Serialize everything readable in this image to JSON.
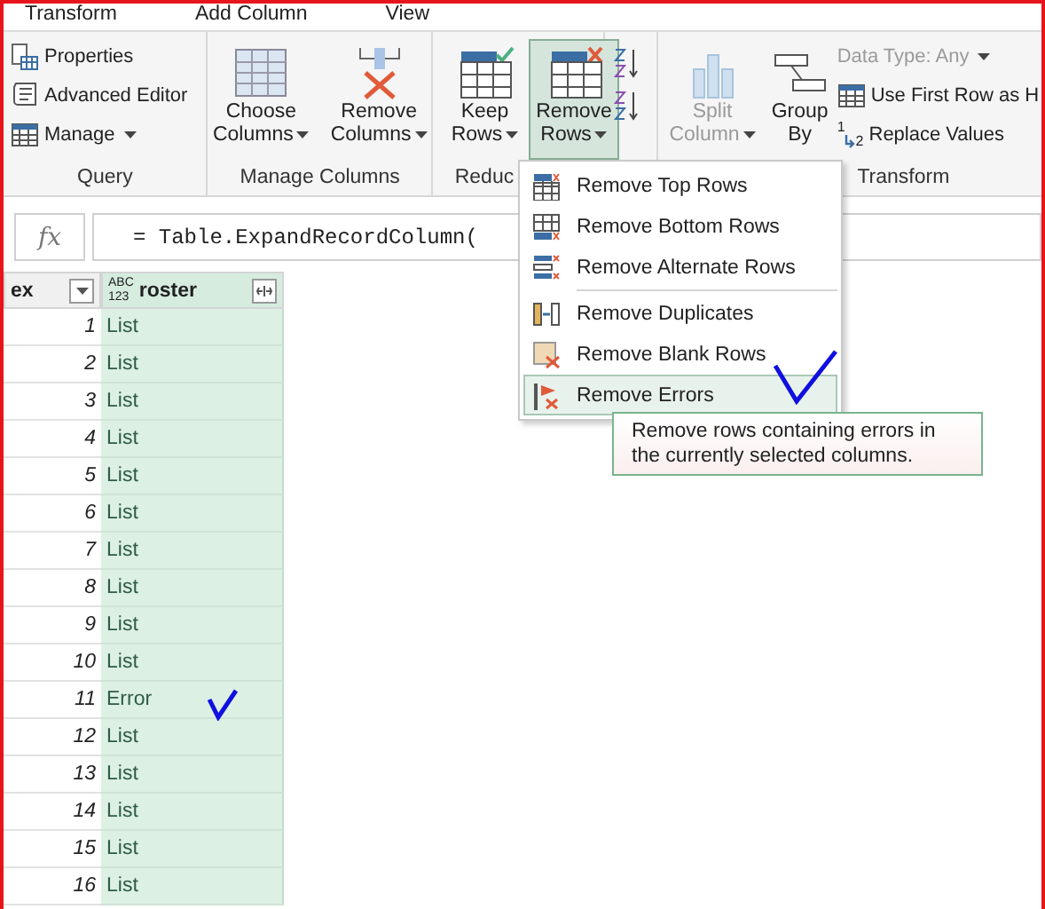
{
  "tabs": [
    {
      "label": "Transform"
    },
    {
      "label": "Add Column"
    },
    {
      "label": "View"
    }
  ],
  "query_group": {
    "label": "Query",
    "items": [
      {
        "label": "Properties",
        "has_menu": false
      },
      {
        "label": "Advanced Editor",
        "has_menu": false
      },
      {
        "label": "Manage",
        "has_menu": true
      }
    ]
  },
  "manage_group": {
    "label": "Manage Columns",
    "buttons": [
      {
        "lines": [
          "Choose",
          "Columns"
        ],
        "has_menu": true,
        "selected": false
      },
      {
        "lines": [
          "Remove",
          "Columns"
        ],
        "has_menu": true,
        "selected": false
      }
    ]
  },
  "reduce_group": {
    "label": "Reduc",
    "buttons": [
      {
        "lines": [
          "Keep",
          "Rows"
        ],
        "has_menu": true,
        "selected": false
      },
      {
        "lines": [
          "Remove",
          "Rows"
        ],
        "has_menu": true,
        "selected": true
      }
    ]
  },
  "transform_group": {
    "label": "Transform",
    "buttons": [
      {
        "lines": [
          "Split",
          "Column"
        ],
        "has_menu": true,
        "disabled": true
      },
      {
        "lines": [
          "Group",
          "By"
        ],
        "has_menu": false,
        "disabled": false
      }
    ],
    "small_items": [
      {
        "label": "Data Type: Any",
        "has_menu": true,
        "disabled": true
      },
      {
        "label": "Use First Row as H",
        "has_menu": false,
        "disabled": false
      },
      {
        "label": "Replace Values",
        "icon_marks": [
          "1",
          "2"
        ],
        "has_menu": false,
        "disabled": false
      }
    ]
  },
  "formula_bar": {
    "fx": "fx",
    "value": "= Table.ExpandRecordColumn("
  },
  "table": {
    "columns": [
      {
        "label": "ex"
      },
      {
        "label": "roster",
        "type_label": [
          "ABC",
          "123"
        ]
      }
    ],
    "rows": [
      {
        "index": "1",
        "value": "List"
      },
      {
        "index": "2",
        "value": "List"
      },
      {
        "index": "3",
        "value": "List"
      },
      {
        "index": "4",
        "value": "List"
      },
      {
        "index": "5",
        "value": "List"
      },
      {
        "index": "6",
        "value": "List"
      },
      {
        "index": "7",
        "value": "List"
      },
      {
        "index": "8",
        "value": "List"
      },
      {
        "index": "9",
        "value": "List"
      },
      {
        "index": "10",
        "value": "List"
      },
      {
        "index": "11",
        "value": "Error"
      },
      {
        "index": "12",
        "value": "List"
      },
      {
        "index": "13",
        "value": "List"
      },
      {
        "index": "14",
        "value": "List"
      },
      {
        "index": "15",
        "value": "List"
      },
      {
        "index": "16",
        "value": "List"
      }
    ]
  },
  "menu": {
    "items": [
      {
        "label": "Remove Top Rows",
        "separator_before": false,
        "selected": false
      },
      {
        "label": "Remove Bottom Rows",
        "separator_before": false,
        "selected": false
      },
      {
        "label": "Remove Alternate Rows",
        "separator_before": false,
        "selected": false
      },
      {
        "label": "Remove Duplicates",
        "separator_before": true,
        "selected": false
      },
      {
        "label": "Remove Blank Rows",
        "separator_before": false,
        "selected": false
      },
      {
        "label": "Remove Errors",
        "separator_before": false,
        "selected": true
      }
    ]
  },
  "tooltip": {
    "text": "Remove rows containing errors in the currently selected columns."
  }
}
